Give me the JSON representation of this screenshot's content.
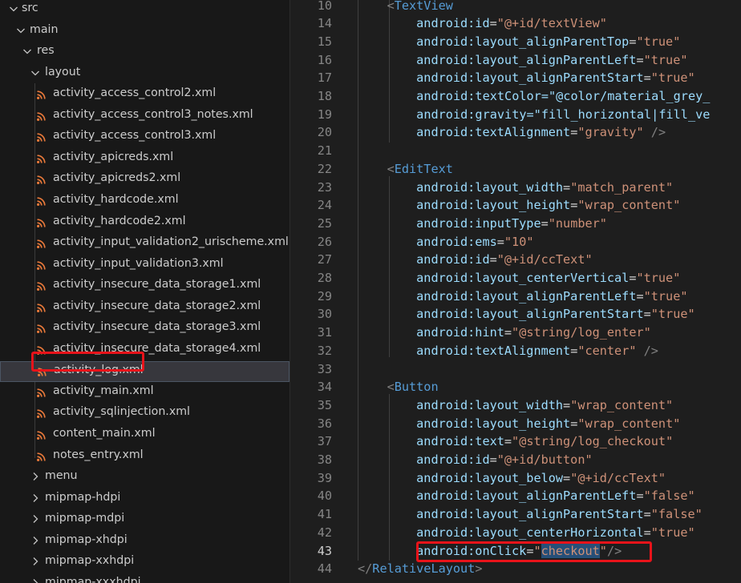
{
  "explorer": {
    "rows": [
      {
        "label": "src",
        "type": "folder-open"
      },
      {
        "label": "main",
        "type": "folder-open"
      },
      {
        "label": "res",
        "type": "folder-open"
      },
      {
        "label": "layout",
        "type": "folder-open"
      },
      {
        "label": "activity_access_control2.xml",
        "type": "file"
      },
      {
        "label": "activity_access_control3_notes.xml",
        "type": "file"
      },
      {
        "label": "activity_access_control3.xml",
        "type": "file"
      },
      {
        "label": "activity_apicreds.xml",
        "type": "file"
      },
      {
        "label": "activity_apicreds2.xml",
        "type": "file"
      },
      {
        "label": "activity_hardcode.xml",
        "type": "file"
      },
      {
        "label": "activity_hardcode2.xml",
        "type": "file"
      },
      {
        "label": "activity_input_validation2_urischeme.xml",
        "type": "file"
      },
      {
        "label": "activity_input_validation3.xml",
        "type": "file"
      },
      {
        "label": "activity_insecure_data_storage1.xml",
        "type": "file"
      },
      {
        "label": "activity_insecure_data_storage2.xml",
        "type": "file"
      },
      {
        "label": "activity_insecure_data_storage3.xml",
        "type": "file"
      },
      {
        "label": "activity_insecure_data_storage4.xml",
        "type": "file"
      },
      {
        "label": "activity_log.xml",
        "type": "file",
        "selected": true
      },
      {
        "label": "activity_main.xml",
        "type": "file"
      },
      {
        "label": "activity_sqlinjection.xml",
        "type": "file"
      },
      {
        "label": "content_main.xml",
        "type": "file"
      },
      {
        "label": "notes_entry.xml",
        "type": "file"
      },
      {
        "label": "menu",
        "type": "folder-closed"
      },
      {
        "label": "mipmap-hdpi",
        "type": "folder-closed"
      },
      {
        "label": "mipmap-mdpi",
        "type": "folder-closed"
      },
      {
        "label": "mipmap-xhdpi",
        "type": "folder-closed"
      },
      {
        "label": "mipmap-xxhdpi",
        "type": "folder-closed"
      },
      {
        "label": "mipmap-xxxhdpi",
        "type": "folder-closed"
      }
    ]
  },
  "editor": {
    "active_line": "43",
    "lines": [
      {
        "num": "10",
        "text": "    <TextView"
      },
      {
        "num": "14",
        "text": "        android:id=\"@+id/textView\""
      },
      {
        "num": "15",
        "text": "        android:layout_alignParentTop=\"true\""
      },
      {
        "num": "16",
        "text": "        android:layout_alignParentLeft=\"true\""
      },
      {
        "num": "17",
        "text": "        android:layout_alignParentStart=\"true\""
      },
      {
        "num": "18",
        "text": "        android:textColor=\"@color/material_grey_"
      },
      {
        "num": "19",
        "text": "        android:gravity=\"fill_horizontal|fill_ve"
      },
      {
        "num": "20",
        "text": "        android:textAlignment=\"gravity\" />"
      },
      {
        "num": "21",
        "text": ""
      },
      {
        "num": "22",
        "text": "    <EditText"
      },
      {
        "num": "23",
        "text": "        android:layout_width=\"match_parent\""
      },
      {
        "num": "24",
        "text": "        android:layout_height=\"wrap_content\""
      },
      {
        "num": "25",
        "text": "        android:inputType=\"number\""
      },
      {
        "num": "26",
        "text": "        android:ems=\"10\""
      },
      {
        "num": "27",
        "text": "        android:id=\"@+id/ccText\""
      },
      {
        "num": "28",
        "text": "        android:layout_centerVertical=\"true\""
      },
      {
        "num": "29",
        "text": "        android:layout_alignParentLeft=\"true\""
      },
      {
        "num": "30",
        "text": "        android:layout_alignParentStart=\"true\""
      },
      {
        "num": "31",
        "text": "        android:hint=\"@string/log_enter\""
      },
      {
        "num": "32",
        "text": "        android:textAlignment=\"center\" />"
      },
      {
        "num": "33",
        "text": ""
      },
      {
        "num": "34",
        "text": "    <Button"
      },
      {
        "num": "35",
        "text": "        android:layout_width=\"wrap_content\""
      },
      {
        "num": "36",
        "text": "        android:layout_height=\"wrap_content\""
      },
      {
        "num": "37",
        "text": "        android:text=\"@string/log_checkout\""
      },
      {
        "num": "38",
        "text": "        android:id=\"@+id/button\""
      },
      {
        "num": "39",
        "text": "        android:layout_below=\"@+id/ccText\""
      },
      {
        "num": "40",
        "text": "        android:layout_alignParentLeft=\"false\""
      },
      {
        "num": "41",
        "text": "        android:layout_alignParentStart=\"false\""
      },
      {
        "num": "42",
        "text": "        android:layout_centerHorizontal=\"true\""
      },
      {
        "num": "43",
        "text": "        android:onClick=\"checkout\"/>"
      },
      {
        "num": "44",
        "text": "</RelativeLayout>"
      }
    ]
  },
  "colors": {
    "highlight_border": "#e8131a",
    "rss_icon": "#e8793a",
    "xml_tag": "#569cd6",
    "xml_attr": "#9cdcfe",
    "xml_string": "#ce9178",
    "selection": "#264f78"
  },
  "icons": {
    "file": "rss-icon",
    "folder-open": "chevron-down-icon",
    "folder-closed": "chevron-right-icon"
  }
}
